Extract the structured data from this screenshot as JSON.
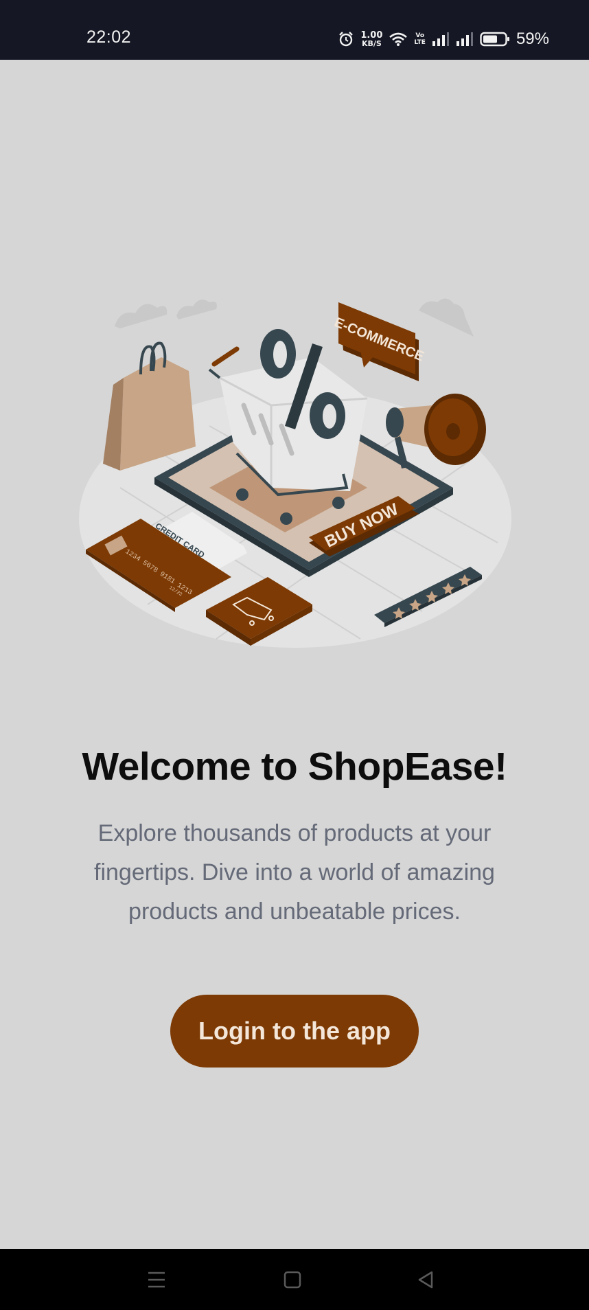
{
  "status_bar": {
    "time": "22:02",
    "net_speed_value": "1.00",
    "net_speed_unit": "KB/S",
    "volte_top": "Vo",
    "volte_bottom": "LTE",
    "battery_percent": "59%",
    "icons": [
      "alarm-icon",
      "wifi-icon",
      "volte-icon",
      "signal-icon",
      "signal-icon",
      "battery-icon"
    ]
  },
  "illustration": {
    "speech_bubble_text": "E-COMMERCE",
    "buy_button_text": "BUY NOW",
    "card_label": "CREDIT CARD",
    "card_number": "1234 5678 9181 1213",
    "card_expiry": "12/23",
    "star_count": 5,
    "colors": {
      "brown": "#7d3a04",
      "dark": "#37474f",
      "tan": "#c7a586",
      "white": "#efefef"
    }
  },
  "welcome": {
    "title": "Welcome to ShopEase!",
    "description": "Explore thousands of products at your fingertips. Dive into a world of amazing products and unbeatable prices."
  },
  "login_button": {
    "label": "Login to the app",
    "color": "#7d3a04"
  },
  "nav_bar": {
    "icons": [
      "menu-icon",
      "home-icon",
      "back-icon"
    ]
  }
}
